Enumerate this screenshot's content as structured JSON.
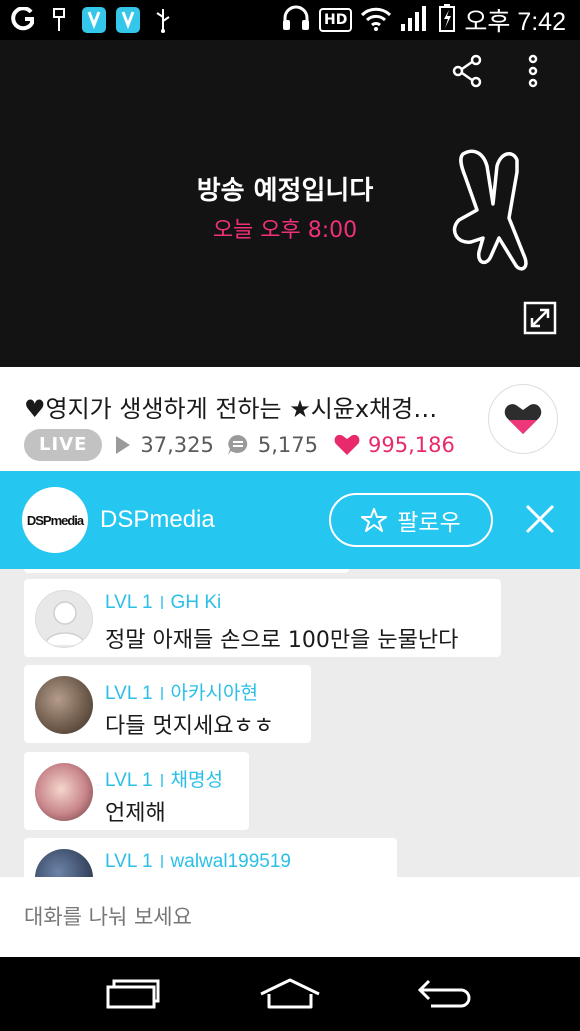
{
  "status_bar": {
    "time": "오후 7:42",
    "hd_label": "HD",
    "icons": [
      "app-g-icon",
      "usb-icon",
      "v-app-icon",
      "v-app-icon",
      "usb-icon",
      "headset-icon",
      "hd-icon",
      "wifi-icon",
      "signal-icon",
      "battery-charging-icon"
    ]
  },
  "player": {
    "message": "방송 예정입니다",
    "schedule": "오늘 오후 8:00",
    "accent": "#f1307a"
  },
  "video": {
    "title": "♥영지가 생생하게 전하는 ★시윤x채경…",
    "live_label": "LIVE",
    "views": "37,325",
    "comments": "5,175",
    "likes": "995,186"
  },
  "channel": {
    "logo_text": "DSPmedia",
    "name": "DSPmedia",
    "follow_label": "팔로우",
    "color": "#25c6f0"
  },
  "chat": {
    "messages": [
      {
        "level": "LVL 1",
        "user": "GH Ki",
        "text": "정말 아재들 손으로 100만을 눈물난다"
      },
      {
        "level": "LVL 1",
        "user": "아카시아현",
        "text": "다들 멋지세요ㅎㅎ"
      },
      {
        "level": "LVL 1",
        "user": "채명성",
        "text": "언제해"
      },
      {
        "level": "LVL 1",
        "user": "walwal199519",
        "text": ""
      }
    ]
  },
  "input": {
    "placeholder": "대화를 나눠 보세요"
  }
}
